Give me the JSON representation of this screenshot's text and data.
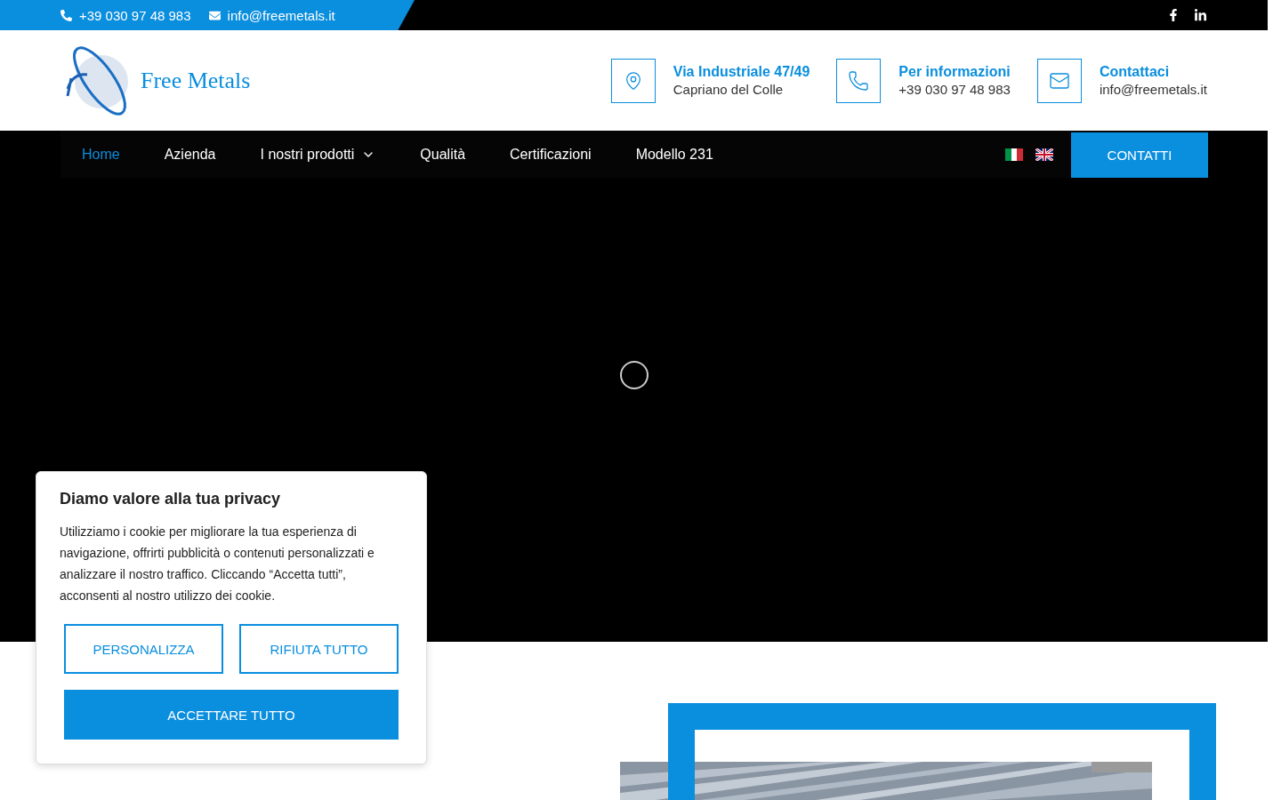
{
  "topbar": {
    "phone": "+39 030 97 48 983",
    "email": "info@freemetals.it"
  },
  "header": {
    "logo_text": "Free Metals",
    "contacts": [
      {
        "kind": "location",
        "title": "Via Industriale 47/49",
        "detail": "Capriano del Colle"
      },
      {
        "kind": "phone",
        "title": "Per informazioni",
        "detail": "+39 030 97 48 983"
      },
      {
        "kind": "mail",
        "title": "Contattaci",
        "detail": "info@freemetals.it"
      }
    ]
  },
  "nav": {
    "items": [
      {
        "label": "Home",
        "selected": true,
        "dropdown": false
      },
      {
        "label": "Azienda",
        "selected": false,
        "dropdown": false
      },
      {
        "label": "I nostri prodotti",
        "selected": false,
        "dropdown": true
      },
      {
        "label": "Qualità",
        "selected": false,
        "dropdown": false
      },
      {
        "label": "Certificazioni",
        "selected": false,
        "dropdown": false
      },
      {
        "label": "Modello 231",
        "selected": false,
        "dropdown": false
      }
    ],
    "flags": [
      {
        "kind": "it"
      },
      {
        "kind": "uk"
      }
    ],
    "cta": "CONTATTI"
  },
  "cookie": {
    "title": "Diamo valore alla tua privacy",
    "text": "Utilizziamo i cookie per migliorare la tua esperienza di navigazione, offrirti pubblicità o contenuti personalizzati e analizzare il nostro traffico. Cliccando “Accetta tutti”, acconsenti al nostro utilizzo dei cookie.",
    "buttons": [
      {
        "label": "PERSONALIZZA",
        "kind": "outline"
      },
      {
        "label": "RIFIUTA TUTTO",
        "kind": "outline"
      },
      {
        "label": "ACCETTARE TUTTO",
        "kind": "filled"
      }
    ]
  }
}
